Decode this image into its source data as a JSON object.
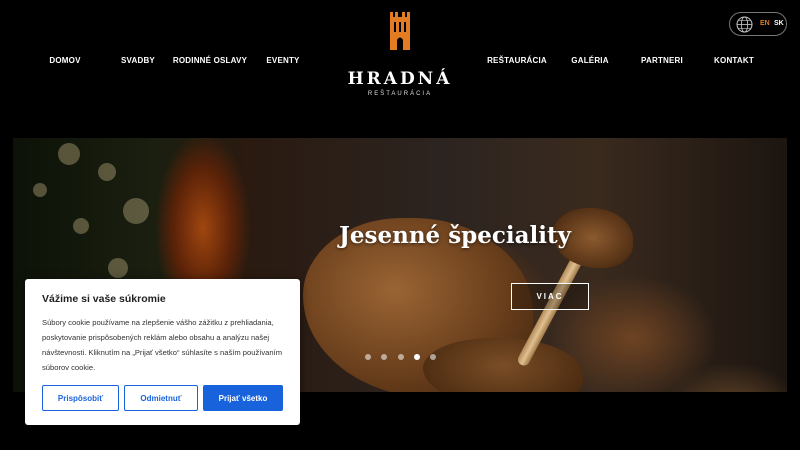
{
  "nav": {
    "left": [
      "DOMOV",
      "SVADBY",
      "RODINNÉ OSLAVY",
      "EVENTY"
    ],
    "right": [
      "REŠTAURÁCIA",
      "GALÉRIA",
      "PARTNERI",
      "KONTAKT"
    ]
  },
  "logo": {
    "title": "HRADNÁ",
    "subtitle": "REŠTAURÁCIA",
    "mark": "castle-tower-icon"
  },
  "lang": {
    "en": "EN",
    "sk": "SK",
    "icon": "globe-icon"
  },
  "hero": {
    "title": "Jesenné špeciality",
    "button": "VIAC",
    "slide_count": 5,
    "active_slide": 4
  },
  "cookie": {
    "title": "Vážime si vaše súkromie",
    "text": "Súbory cookie používame na zlepšenie vášho zážitku z prehliadania, poskytovanie prispôsobených reklám alebo obsahu a analýzu našej návštevnosti. Kliknutím na „Prijať všetko“ súhlasíte s naším používaním súborov cookie.",
    "customize": "Prispôsobiť",
    "reject": "Odmietnuť",
    "accept": "Prijať všetko"
  },
  "colors": {
    "accent": "#e37b22",
    "cookie_blue": "#1863dc",
    "background": "#000000"
  }
}
